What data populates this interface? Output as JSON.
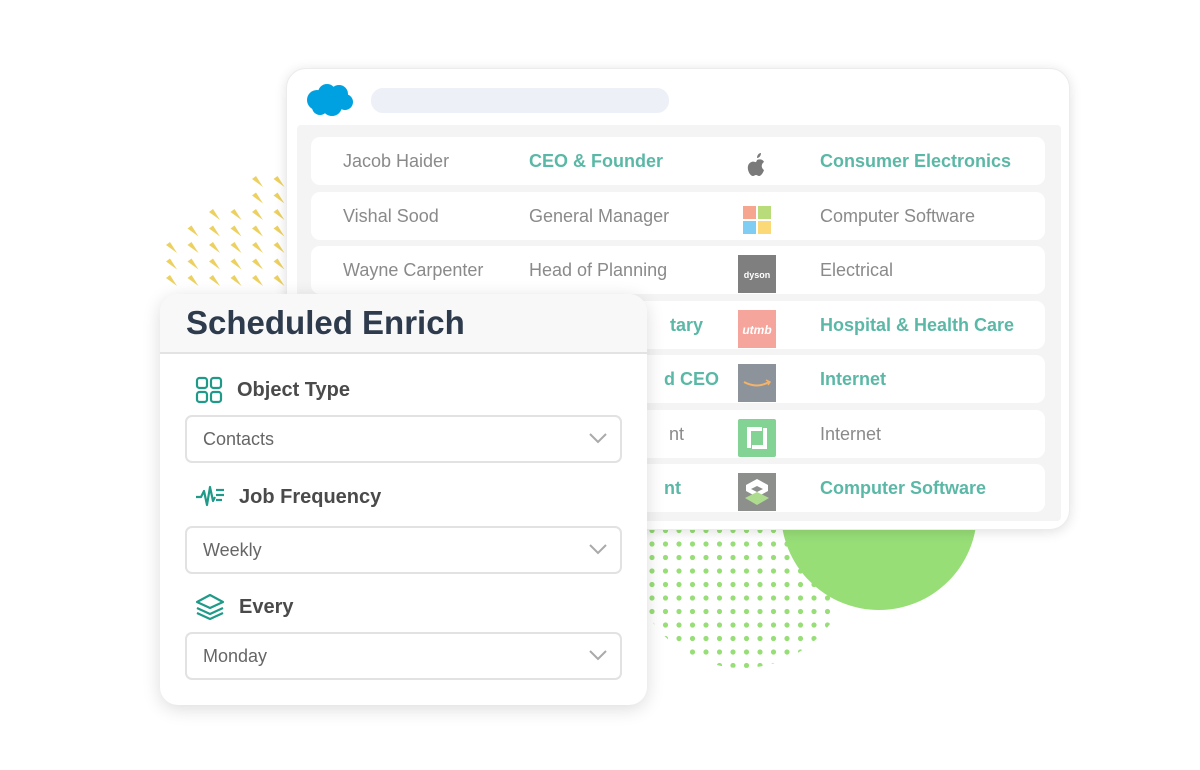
{
  "colors": {
    "accent": "#5bb8a6",
    "icon_teal": "#1f9a89",
    "title": "#2e3b4c",
    "green": "#97de77",
    "yellow": "#ecd160",
    "salesforce": "#00a1e0"
  },
  "crm_window": {
    "logo": "salesforce-cloud-icon",
    "rows": [
      {
        "name": "Jacob Haider",
        "title": "CEO & Founder",
        "logo": "apple-logo",
        "industry": "Consumer Electronics",
        "highlight": true
      },
      {
        "name": "Vishal Sood",
        "title": "General Manager",
        "logo": "microsoft-logo",
        "industry": "Computer Software",
        "highlight": false
      },
      {
        "name": "Wayne Carpenter",
        "title": "Head of Planning",
        "logo": "dyson-logo",
        "logo_text": "dyson",
        "industry": "Electrical",
        "highlight": false
      },
      {
        "name": "",
        "title": "tary",
        "logo": "utmb-logo",
        "logo_text": "utmb",
        "industry": "Hospital & Health Care",
        "highlight": true
      },
      {
        "name": "",
        "title": "d CEO",
        "logo": "amazon-logo",
        "industry": "Internet",
        "highlight": true
      },
      {
        "name": "",
        "title": "nt",
        "logo": "glassdoor-logo",
        "industry": "Internet",
        "highlight": false
      },
      {
        "name": "",
        "title": "nt",
        "logo": "layers-company-logo",
        "industry": "Computer Software",
        "highlight": true
      }
    ]
  },
  "panel": {
    "title": "Scheduled Enrich",
    "fields": [
      {
        "label": "Object Type",
        "icon": "grid-icon",
        "value": "Contacts"
      },
      {
        "label": "Job Frequency",
        "icon": "pulse-icon",
        "value": "Weekly"
      },
      {
        "label": "Every",
        "icon": "layers-icon",
        "value": "Monday"
      }
    ]
  }
}
